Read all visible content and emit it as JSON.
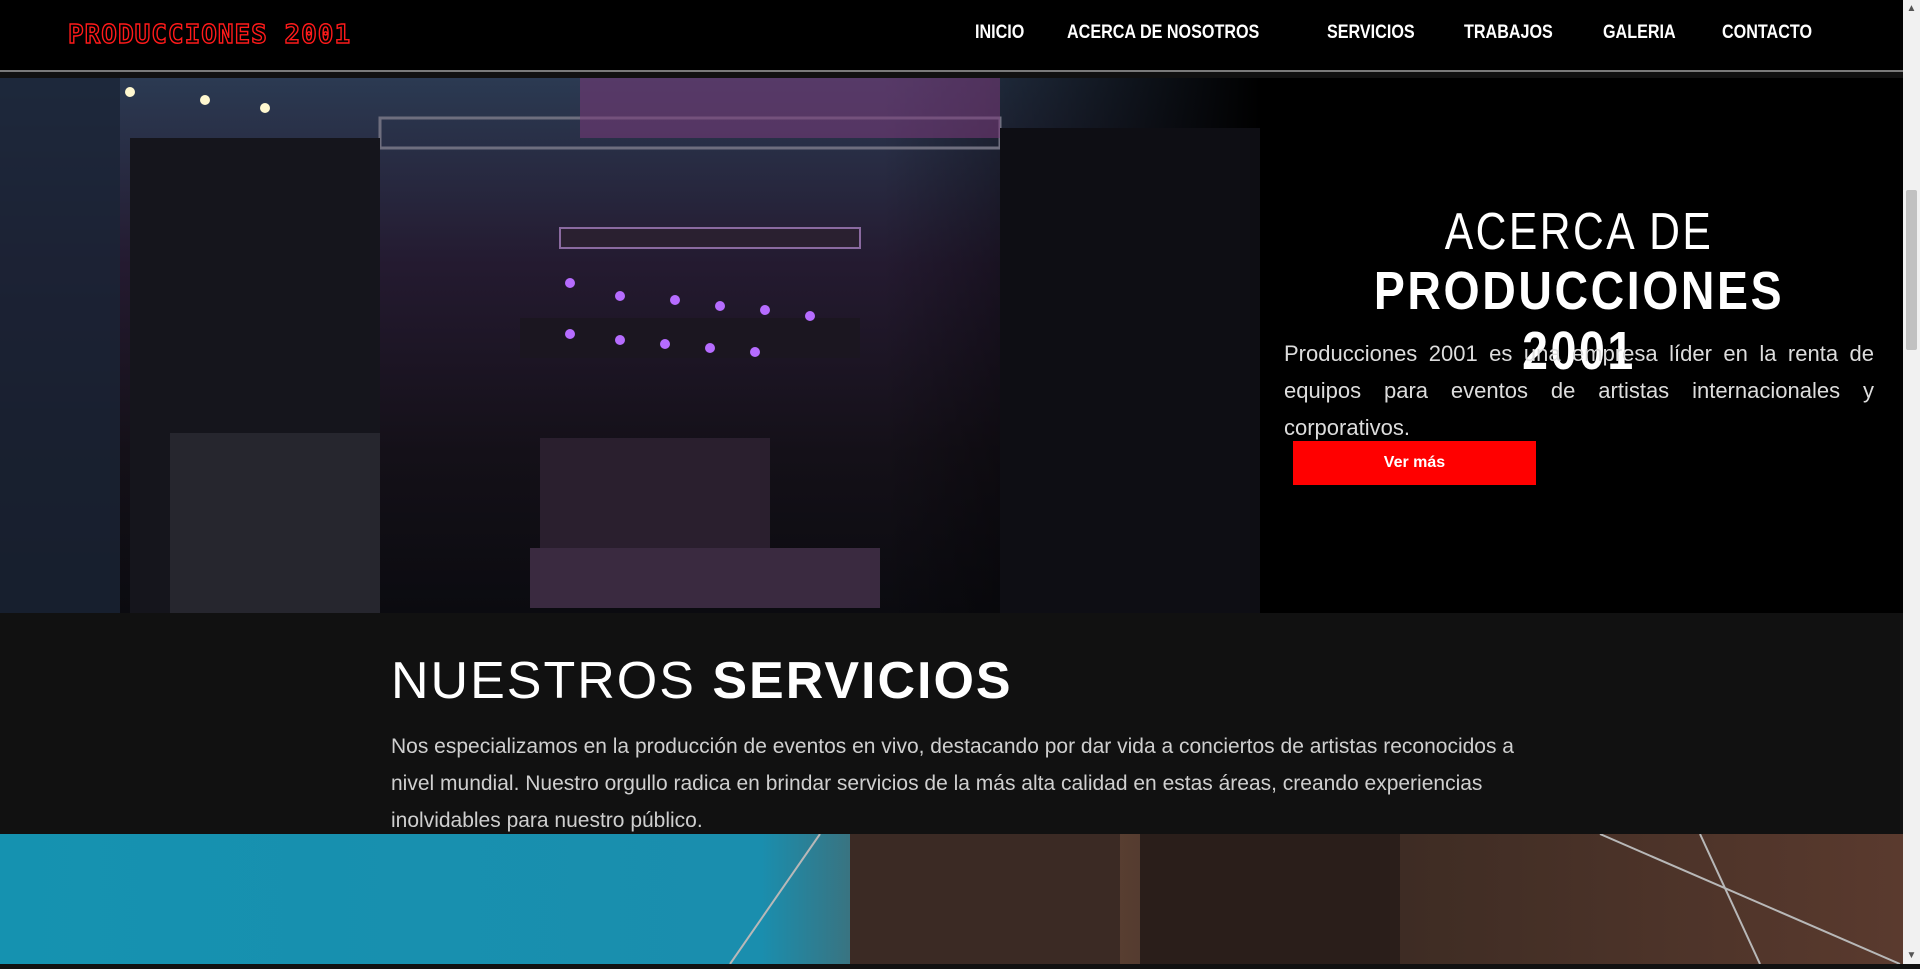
{
  "brand": {
    "logo_text": "PRODUCCIONES 2001"
  },
  "nav": {
    "links": [
      "INICIO",
      "ACERCA DE NOSOTROS",
      "SERVICIOS",
      "TRABAJOS",
      "GALERIA",
      "CONTACTO"
    ]
  },
  "hero": {
    "title_light": "ACERCA DE",
    "title_bold": "PRODUCCIONES 2001",
    "description": "Producciones 2001 es una empresa líder en la renta de equipos para eventos de artistas internacionales y corporativos.",
    "cta_label": "Ver más"
  },
  "services": {
    "title_light": "NUESTROS",
    "title_bold": "SERVICIOS",
    "description": "Nos especializamos en la producción de eventos en vivo, destacando por dar vida a conciertos de artistas reconocidos a nivel mundial. Nuestro orgullo radica en brindar servicios de la más alta calidad en estas áreas, creando experiencias inolvidables para nuestro público."
  },
  "colors": {
    "accent": "#ff0000",
    "nav_bg": "#000000",
    "section_bg": "#111111"
  }
}
